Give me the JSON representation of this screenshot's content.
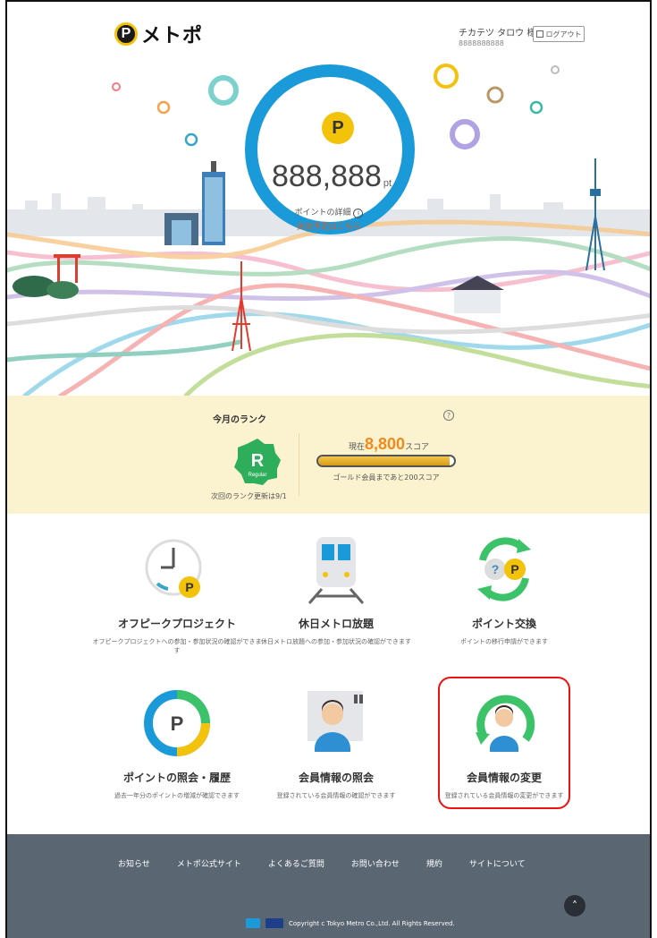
{
  "header": {
    "logo_p": "P",
    "logo_text": "メトポ",
    "user_name": "チカテツ タロウ 様",
    "user_id": "8888888888",
    "logout_label": "ログアウト"
  },
  "points": {
    "badge": "P",
    "value": "888,888",
    "unit": "pt",
    "detail_link": "ポイントの詳細",
    "expire_link": "失効予定はこちら"
  },
  "rank": {
    "title": "今月のランク",
    "help": "?",
    "badge_letter": "R",
    "badge_word": "Regular",
    "update_note": "次回のランク更新は9/1",
    "current_prefix": "現在",
    "current_score": "8,800",
    "score_unit": "スコア",
    "progress": 0.97,
    "next_note": "ゴールド会員まであと200スコア"
  },
  "menu": [
    {
      "label": "オフピークプロジェクト",
      "desc": "オフピークプロジェクトへの参加・参加状況の確認ができます"
    },
    {
      "label": "休日メトロ放題",
      "desc": "休日メトロ放題への参加・参加状況の確認ができます"
    },
    {
      "label": "ポイント交換",
      "desc": "ポイントの移行申請ができます"
    },
    {
      "label": "ポイントの照会・履歴",
      "desc": "過去一年分のポイントの増減が確認できます"
    },
    {
      "label": "会員情報の照会",
      "desc": "登録されている会員情報の確認ができます"
    },
    {
      "label": "会員情報の変更",
      "desc": "登録されている会員情報の変更ができます"
    }
  ],
  "footer": {
    "links": [
      "お知らせ",
      "メトポ公式サイト",
      "よくあるご質問",
      "お問い合わせ",
      "規約",
      "サイトについて"
    ],
    "copyright": "Copyright c Tokyo Metro Co.,Ltd. All Rights Reserved.",
    "top_icon": "chevron-up-icon"
  }
}
